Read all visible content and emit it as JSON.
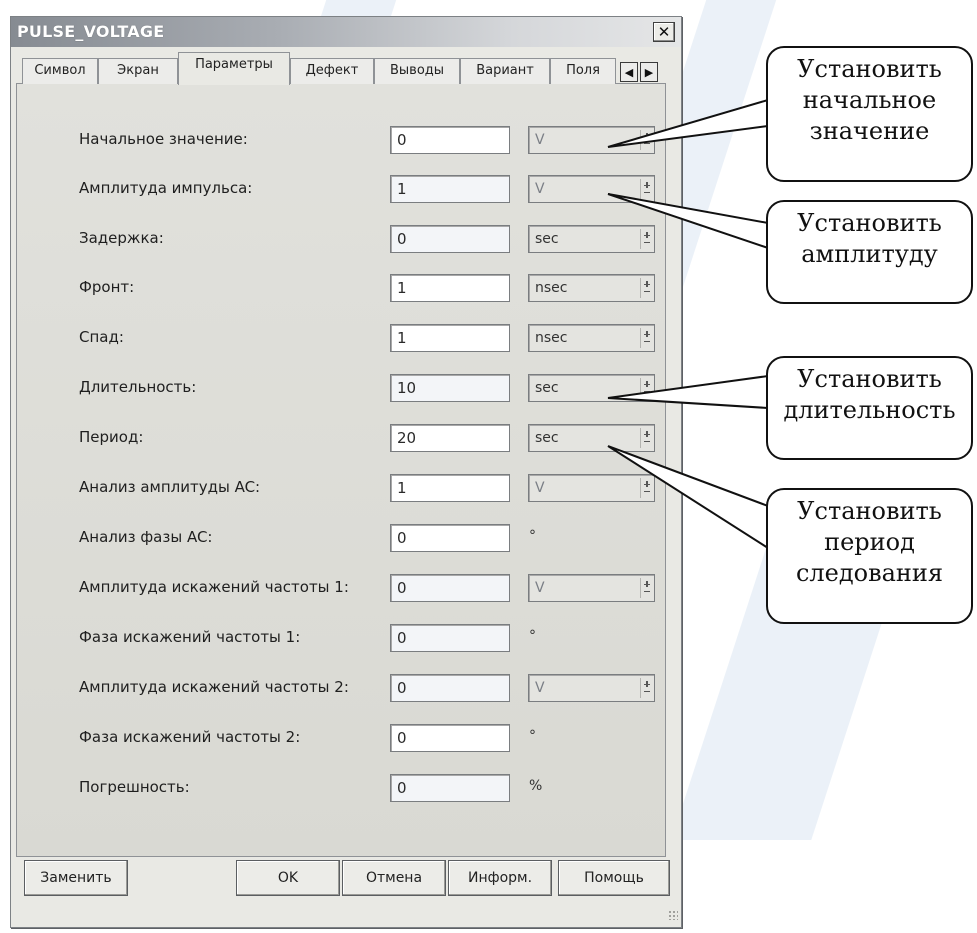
{
  "window": {
    "title": "PULSE_VOLTAGE",
    "close_label": "✕"
  },
  "tabs": [
    {
      "label": "Символ",
      "active": false
    },
    {
      "label": "Экран",
      "active": false
    },
    {
      "label": "Параметры",
      "active": true
    },
    {
      "label": "Дефект",
      "active": false
    },
    {
      "label": "Выводы",
      "active": false
    },
    {
      "label": "Вариант",
      "active": false
    },
    {
      "label": "Поля",
      "active": false
    }
  ],
  "tab_scroll": {
    "left": "◀",
    "right": "▶"
  },
  "params": [
    {
      "label": "Начальное значение:",
      "value": "0",
      "unit": "V"
    },
    {
      "label": "Амплитуда импульса:",
      "value": "1",
      "unit": "V"
    },
    {
      "label": "Задержка:",
      "value": "0",
      "unit": "sec"
    },
    {
      "label": "Фронт:",
      "value": "1",
      "unit": "nsec"
    },
    {
      "label": "Спад:",
      "value": "1",
      "unit": "nsec"
    },
    {
      "label": "Длительность:",
      "value": "10",
      "unit": "sec"
    },
    {
      "label": "Период:",
      "value": "20",
      "unit": "sec"
    },
    {
      "label": "Анализ амплитуды AC:",
      "value": "1",
      "unit": "V"
    },
    {
      "label": "Анализ фазы AC:",
      "value": "0",
      "unit": "°"
    },
    {
      "label": "Амплитуда искажений частоты 1:",
      "value": "0",
      "unit": "V"
    },
    {
      "label": "Фаза искажений частоты 1:",
      "value": "0",
      "unit": "°"
    },
    {
      "label": "Амплитуда искажений частоты 2:",
      "value": "0",
      "unit": "V"
    },
    {
      "label": "Фаза искажений частоты 2:",
      "value": "0",
      "unit": "°"
    },
    {
      "label": "Погрешность:",
      "value": "0",
      "unit": "%"
    }
  ],
  "buttons": {
    "replace": "Заменить",
    "ok": "OK",
    "cancel": "Отмена",
    "info": "Информ.",
    "help": "Помощь"
  },
  "callouts": {
    "initial": [
      "Установить",
      "начальное",
      "значение"
    ],
    "amplitude": [
      "Установить",
      "амплитуду"
    ],
    "duration": [
      "Установить",
      "длительность"
    ],
    "period": [
      "Установить",
      "период",
      "следования"
    ]
  }
}
